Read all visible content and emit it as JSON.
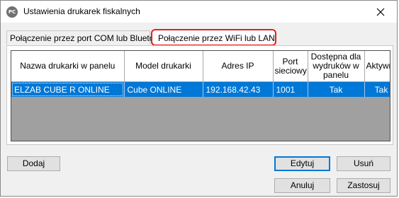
{
  "window": {
    "title": "Ustawienia drukarek fiskalnych",
    "app_icon": "app-icon",
    "close_icon": "close-icon"
  },
  "tabs": [
    {
      "label": "Połączenie przez port COM lub Bluetooth",
      "selected": false
    },
    {
      "label": "Połączenie przez WiFi lub LAN",
      "selected": true
    }
  ],
  "grid": {
    "headers": [
      "Nazwa drukarki w panelu",
      "Model drukarki",
      "Adres IP",
      "Port sieciowy",
      "Dostępna dla wydruków w panelu",
      "Aktywna"
    ],
    "rows": [
      {
        "name": "ELZAB CUBE R ONLINE",
        "model": "Cube ONLINE",
        "ip": "192.168.42.43",
        "port": "1001",
        "available": "Tak",
        "active": "Tak",
        "selected": true
      }
    ]
  },
  "buttons": {
    "add": "Dodaj",
    "edit": "Edytuj",
    "delete": "Usuń",
    "cancel": "Anuluj",
    "save": "Zastosuj"
  },
  "colors": {
    "selection": "#0078d7",
    "highlight_border": "#e0201a",
    "grid_background": "#a0a0a0"
  }
}
